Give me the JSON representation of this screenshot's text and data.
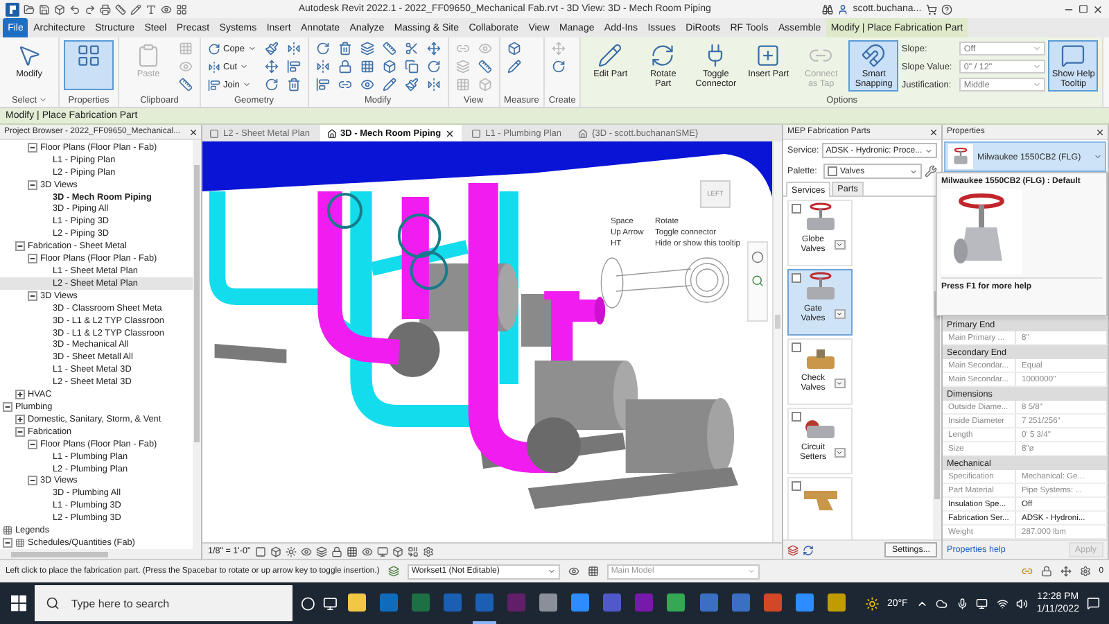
{
  "title_bar": {
    "title": "Autodesk Revit 2022.1 - 2022_FF09650_Mechanical Fab.rvt - 3D View: 3D - Mech Room Piping",
    "user": "scott.buchana..."
  },
  "ribbon_tabs": [
    {
      "label": "File",
      "kind": "file",
      "selected": false
    },
    {
      "label": "Architecture",
      "kind": "tab",
      "selected": false
    },
    {
      "label": "Structure",
      "kind": "tab",
      "selected": false
    },
    {
      "label": "Steel",
      "kind": "tab",
      "selected": false
    },
    {
      "label": "Precast",
      "kind": "tab",
      "selected": false
    },
    {
      "label": "Systems",
      "kind": "tab",
      "selected": false
    },
    {
      "label": "Insert",
      "kind": "tab",
      "selected": false
    },
    {
      "label": "Annotate",
      "kind": "tab",
      "selected": false
    },
    {
      "label": "Analyze",
      "kind": "tab",
      "selected": false
    },
    {
      "label": "Massing & Site",
      "kind": "tab",
      "selected": false
    },
    {
      "label": "Collaborate",
      "kind": "tab",
      "selected": false
    },
    {
      "label": "View",
      "kind": "tab",
      "selected": false
    },
    {
      "label": "Manage",
      "kind": "tab",
      "selected": false
    },
    {
      "label": "Add-Ins",
      "kind": "tab",
      "selected": false
    },
    {
      "label": "Issues",
      "kind": "tab",
      "selected": false
    },
    {
      "label": "DiRoots",
      "kind": "tab",
      "selected": false
    },
    {
      "label": "RF Tools",
      "kind": "tab",
      "selected": false
    },
    {
      "label": "Assemble",
      "kind": "tab",
      "selected": false
    },
    {
      "label": "Modify | Place Fabrication Part",
      "kind": "context",
      "selected": true
    }
  ],
  "ribbon_groups": [
    {
      "label": "Select",
      "dropdown": true,
      "contextual": false,
      "tools": [
        {
          "kind": "large",
          "label": "Modify",
          "selected": false,
          "disabled": false
        }
      ]
    },
    {
      "label": "Properties",
      "dropdown": false,
      "contextual": false,
      "tools": [
        {
          "kind": "large",
          "selected": true,
          "disabled": false
        }
      ]
    },
    {
      "label": "Clipboard",
      "dropdown": false,
      "contextual": false,
      "tools": [
        {
          "kind": "large",
          "label": "Paste",
          "selected": false,
          "disabled": true
        },
        {
          "kind": "icon",
          "disabled": true
        },
        {
          "kind": "icon",
          "disabled": true
        },
        {
          "kind": "icon",
          "disabled": false
        }
      ]
    },
    {
      "label": "Geometry",
      "dropdown": false,
      "contextual": false,
      "tools": [
        {
          "kind": "small",
          "label": "Cope",
          "disabled": false
        },
        {
          "kind": "small",
          "label": "Cut",
          "disabled": false
        },
        {
          "kind": "small",
          "label": "Join",
          "disabled": false
        },
        {
          "kind": "icon",
          "disabled": false
        },
        {
          "kind": "icon",
          "disabled": false
        },
        {
          "kind": "icon",
          "disabled": false
        },
        {
          "kind": "icon",
          "disabled": false
        },
        {
          "kind": "icon",
          "disabled": false
        },
        {
          "kind": "icon",
          "disabled": false
        }
      ]
    },
    {
      "label": "Modify",
      "dropdown": false,
      "contextual": false,
      "tools": [
        {
          "kind": "icon",
          "disabled": false
        },
        {
          "kind": "icon",
          "disabled": false
        },
        {
          "kind": "icon",
          "disabled": false
        },
        {
          "kind": "icon",
          "disabled": false
        },
        {
          "kind": "icon",
          "disabled": false
        },
        {
          "kind": "icon",
          "disabled": false
        },
        {
          "kind": "icon",
          "disabled": false
        },
        {
          "kind": "icon",
          "disabled": false
        },
        {
          "kind": "icon",
          "disabled": false
        },
        {
          "kind": "icon",
          "disabled": false
        },
        {
          "kind": "icon",
          "disabled": false
        },
        {
          "kind": "icon",
          "disabled": false
        },
        {
          "kind": "icon",
          "disabled": false
        },
        {
          "kind": "icon",
          "disabled": false
        },
        {
          "kind": "icon",
          "disabled": false
        },
        {
          "kind": "icon",
          "disabled": false
        },
        {
          "kind": "icon",
          "disabled": false
        },
        {
          "kind": "icon",
          "disabled": false
        }
      ]
    },
    {
      "label": "View",
      "dropdown": false,
      "contextual": false,
      "tools": [
        {
          "kind": "icon",
          "disabled": true
        },
        {
          "kind": "icon",
          "disabled": true
        },
        {
          "kind": "icon",
          "disabled": true
        },
        {
          "kind": "icon",
          "disabled": true
        },
        {
          "kind": "icon",
          "disabled": false
        },
        {
          "kind": "icon",
          "disabled": true
        }
      ]
    },
    {
      "label": "Measure",
      "dropdown": false,
      "contextual": false,
      "tools": [
        {
          "kind": "icon",
          "disabled": false
        },
        {
          "kind": "icon",
          "disabled": false
        }
      ]
    },
    {
      "label": "Create",
      "dropdown": false,
      "contextual": false,
      "tools": [
        {
          "kind": "icon",
          "disabled": true
        },
        {
          "kind": "icon",
          "disabled": false
        }
      ]
    },
    {
      "label": "Options",
      "dropdown": false,
      "contextual": true,
      "tools": [
        {
          "kind": "large",
          "label": "Edit Part",
          "selected": false,
          "disabled": false
        },
        {
          "kind": "large",
          "label": "Rotate Part",
          "selected": false,
          "disabled": false
        },
        {
          "kind": "large",
          "label": "Toggle Connector",
          "selected": false,
          "disabled": false
        },
        {
          "kind": "large",
          "label": "Insert Part",
          "selected": false,
          "disabled": false
        },
        {
          "kind": "large",
          "label": "Connect as Tap",
          "selected": false,
          "disabled": true
        },
        {
          "kind": "large",
          "label": "Smart Snapping",
          "selected": true,
          "disabled": false
        },
        {
          "kind": "field",
          "label": "Slope:",
          "value": "Off",
          "disabled": true
        },
        {
          "kind": "field",
          "label": "Slope Value:",
          "value": "0\" / 12\"",
          "disabled": true
        },
        {
          "kind": "field",
          "label": "Justification:",
          "value": "Middle",
          "disabled": true
        },
        {
          "kind": "large",
          "label": "Show Help Tooltip",
          "selected": true,
          "disabled": false
        }
      ]
    }
  ],
  "context_label": "Modify | Place Fabrication Part",
  "project_browser": {
    "title": "Project Browser - 2022_FF09650_Mechanical...",
    "tree": [
      {
        "children": [
          {
            "children": [
              {
                "label": "Floor Plans (Floor Plan - Fab)",
                "kind": "group",
                "expanded": true,
                "children": [
                  {
                    "label": "L1 - Piping Plan",
                    "kind": "view",
                    "selected": false,
                    "current": false
                  },
                  {
                    "label": "L2 - Piping Plan",
                    "kind": "view",
                    "selected": false,
                    "current": false
                  }
                ]
              },
              {
                "label": "3D Views",
                "kind": "group",
                "expanded": true,
                "children": [
                  {
                    "label": "3D - Mech Room Piping",
                    "kind": "view",
                    "selected": false,
                    "current": true
                  },
                  {
                    "label": "3D - Piping All",
                    "kind": "view",
                    "selected": false,
                    "current": false
                  },
                  {
                    "label": "L1 - Piping 3D",
                    "kind": "view",
                    "selected": false,
                    "current": false
                  },
                  {
                    "label": "L2 - Piping 3D",
                    "kind": "view",
                    "selected": false,
                    "current": false
                  }
                ]
              }
            ]
          },
          {
            "label": "Fabrication - Sheet Metal",
            "kind": "group",
            "expanded": true,
            "children": [
              {
                "label": "Floor Plans (Floor Plan - Fab)",
                "kind": "group",
                "expanded": true,
                "children": [
                  {
                    "label": "L1 - Sheet Metal Plan",
                    "kind": "view",
                    "selected": false,
                    "current": false
                  },
                  {
                    "label": "L2 - Sheet Metal Plan",
                    "kind": "view",
                    "selected": true,
                    "current": false
                  }
                ]
              },
              {
                "label": "3D Views",
                "kind": "group",
                "expanded": true,
                "children": [
                  {
                    "label": "3D - Classroom Sheet Meta",
                    "kind": "view",
                    "selected": false,
                    "current": false
                  },
                  {
                    "label": "3D - L1 & L2 TYP Classroon",
                    "kind": "view",
                    "selected": false,
                    "current": false
                  },
                  {
                    "label": "3D - L1 & L2 TYP Classroon",
                    "kind": "view",
                    "selected": false,
                    "current": false
                  },
                  {
                    "label": "3D - Mechanical All",
                    "kind": "view",
                    "selected": false,
                    "current": false
                  },
                  {
                    "label": "3D - Sheet Metall All",
                    "kind": "view",
                    "selected": false,
                    "current": false
                  },
                  {
                    "label": "L1 - Sheet Metal 3D",
                    "kind": "view",
                    "selected": false,
                    "current": false
                  },
                  {
                    "label": "L2 - Sheet Metal 3D",
                    "kind": "view",
                    "selected": false,
                    "current": false
                  }
                ]
              }
            ]
          },
          {
            "label": "HVAC",
            "kind": "group",
            "expanded": false
          }
        ]
      },
      {
        "label": "Plumbing",
        "kind": "group",
        "expanded": true,
        "children": [
          {
            "label": "Domestic, Sanitary, Storm, & Vent",
            "kind": "group",
            "expanded": false
          },
          {
            "label": "Fabrication",
            "kind": "group",
            "expanded": true,
            "children": [
              {
                "label": "Floor Plans (Floor Plan - Fab)",
                "kind": "group",
                "expanded": true,
                "children": [
                  {
                    "label": "L1 - Plumbing Plan",
                    "kind": "view",
                    "selected": false,
                    "current": false
                  },
                  {
                    "label": "L2 - Plumbing Plan",
                    "kind": "view",
                    "selected": false,
                    "current": false
                  }
                ]
              },
              {
                "label": "3D Views",
                "kind": "group",
                "expanded": true,
                "children": [
                  {
                    "label": "3D - Plumbing All",
                    "kind": "view",
                    "selected": false,
                    "current": false
                  },
                  {
                    "label": "L1 - Plumbing 3D",
                    "kind": "view",
                    "selected": false,
                    "current": false
                  },
                  {
                    "label": "L2 - Plumbing 3D",
                    "kind": "view",
                    "selected": false,
                    "current": false
                  }
                ]
              }
            ]
          }
        ]
      },
      {
        "label": "Legends",
        "kind": "sheet"
      },
      {
        "label": "Schedules/Quantities (Fab)",
        "kind": "sheet",
        "expanded": true
      }
    ]
  },
  "view": {
    "tabs": [
      {
        "label": "L2 - Sheet Metal Plan",
        "kind": "plan",
        "selected": false
      },
      {
        "label": "3D - Mech Room Piping",
        "kind": "model",
        "selected": true
      },
      {
        "label": "L1 - Plumbing Plan",
        "kind": "plan",
        "selected": false
      },
      {
        "label": "{3D - scott.buchananSME}",
        "kind": "model",
        "selected": false
      }
    ],
    "tooltip": [
      {
        "key": "Space",
        "action": "Rotate"
      },
      {
        "key": "Up Arrow",
        "action": "Toggle connector"
      },
      {
        "key": "HT",
        "action": "Hide or show this tooltip"
      }
    ],
    "view_cube_label": "LEFT",
    "scale": "1/8\" = 1'-0\""
  },
  "fabrication_parts": {
    "title": "MEP Fabrication Parts",
    "service_label": "Service:",
    "service": "ADSK - Hydronic: Proce...",
    "palette_label": "Palette:",
    "palette": "Valves",
    "palette_checked": false,
    "tabs": [
      {
        "label": "Services",
        "selected": true
      },
      {
        "label": "Parts",
        "selected": false
      }
    ],
    "parts": [
      {
        "label": "Globe Valves",
        "kind": "globe",
        "checked": false,
        "selected": false
      },
      {
        "label": "Gate Valves",
        "kind": "gate",
        "checked": false,
        "selected": true
      },
      {
        "label": "Check Valves",
        "kind": "check",
        "checked": false,
        "selected": false
      },
      {
        "label": "Circuit Setters",
        "kind": "circuit",
        "checked": false,
        "selected": false
      },
      {
        "kind": "strainer",
        "checked": false,
        "selected": false
      }
    ],
    "settings_button": "Settings..."
  },
  "properties": {
    "title": "Properties",
    "type_name": "Milwaukee 1550CB2 (FLG)",
    "tooltip": {
      "title": "Milwaukee 1550CB2 (FLG) : Default",
      "hint": "Press F1 for more help"
    },
    "rows": [
      {
        "kind": "header",
        "label": "Primary End"
      },
      {
        "kind": "row",
        "name": "Main Primary ...",
        "value": "8\"",
        "disabled": true
      },
      {
        "kind": "header",
        "label": "Secondary End"
      },
      {
        "kind": "row",
        "name": "Main Secondar...",
        "value": "Equal",
        "disabled": true
      },
      {
        "kind": "row",
        "name": "Main Secondar...",
        "value": "1000000\"",
        "disabled": true
      },
      {
        "kind": "header",
        "label": "Dimensions"
      },
      {
        "kind": "row",
        "name": "Outside Diame...",
        "value": "8 5/8\"",
        "disabled": true
      },
      {
        "kind": "row",
        "name": "Inside Diameter",
        "value": "7 251/256\"",
        "disabled": true
      },
      {
        "kind": "row",
        "name": "Length",
        "value": "0'  5 3/4\"",
        "disabled": true
      },
      {
        "kind": "row",
        "name": "Size",
        "value": "8\"ø",
        "disabled": true
      },
      {
        "kind": "header",
        "label": "Mechanical"
      },
      {
        "kind": "row",
        "name": "Specification",
        "value": "Mechanical: Ge...",
        "disabled": true
      },
      {
        "kind": "row",
        "name": "Part Material",
        "value": "Pipe Systems: ...",
        "disabled": true
      },
      {
        "kind": "row",
        "name": "Insulation Spe...",
        "value": "Off",
        "disabled": false
      },
      {
        "kind": "row",
        "name": "Fabrication Ser...",
        "value": "ADSK - Hydroni...",
        "disabled": false
      },
      {
        "kind": "row",
        "name": "Weight",
        "value": "287.000 lbm",
        "disabled": true
      }
    ],
    "help_link": "Properties help",
    "apply_button": {
      "label": "Apply",
      "disabled": true
    }
  },
  "status_bar": {
    "message": "Left click to place the fabrication part. (Press the Spacebar to rotate or up arrow key to toggle insertion.)",
    "workset": "Workset1 (Not Editable)",
    "design_option": "Main Model",
    "filter_count": "0"
  },
  "taskbar": {
    "search_placeholder": "Type here to search",
    "temperature": "20°F",
    "time": "12:28 PM",
    "date": "1/11/2022"
  }
}
